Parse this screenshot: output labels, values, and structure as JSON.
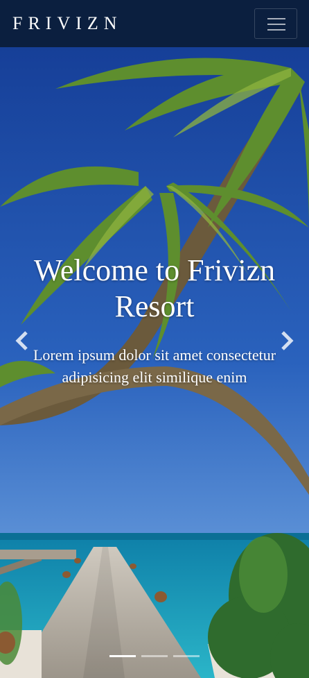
{
  "navbar": {
    "brand": "FRIVIZN",
    "toggle_icon": "hamburger-menu-icon"
  },
  "hero": {
    "title": "Welcome to Frivizn Resort",
    "subtitle": "Lorem ipsum dolor sit amet consectetur adipisicing elit similique enim",
    "prev_icon": "chevron-left-icon",
    "next_icon": "chevron-right-icon",
    "indicators": [
      {
        "active": true
      },
      {
        "active": false
      },
      {
        "active": false
      }
    ]
  },
  "colors": {
    "navbar_bg": "#0b1f3f",
    "text": "#ffffff",
    "sky": "#1f4fa8",
    "sea": "#1a9bb8"
  }
}
